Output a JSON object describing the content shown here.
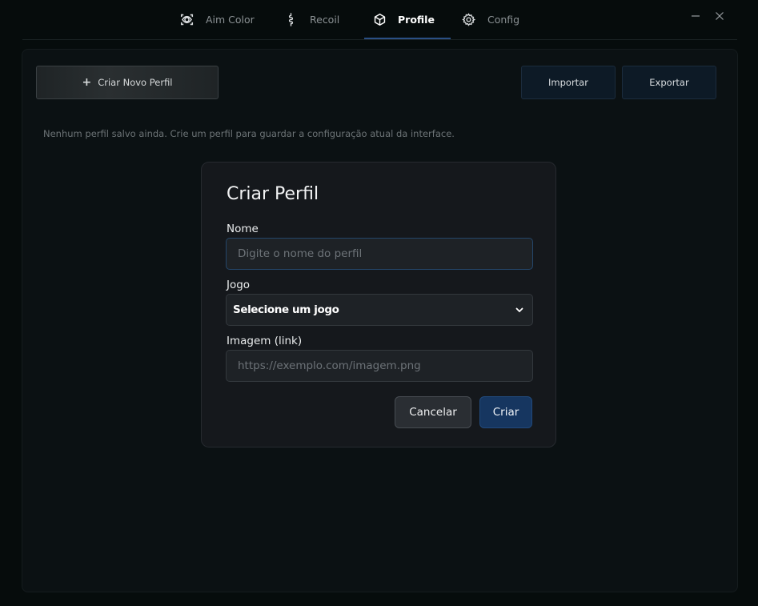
{
  "nav": {
    "tabs": [
      {
        "label": "Aim Color",
        "icon": "eye-target-icon"
      },
      {
        "label": "Recoil",
        "icon": "spiral-icon"
      },
      {
        "label": "Profile",
        "icon": "cube-icon"
      },
      {
        "label": "Config",
        "icon": "gear-icon"
      }
    ],
    "active_tab": "Profile"
  },
  "toolbar": {
    "new_profile_label": "Criar Novo Perfil",
    "import_label": "Importar",
    "export_label": "Exportar"
  },
  "empty_message": "Nenhum perfil salvo ainda. Crie um perfil para guardar a configuração atual da interface.",
  "modal": {
    "title": "Criar Perfil",
    "name_label": "Nome",
    "name_placeholder": "Digite o nome do perfil",
    "name_value": "",
    "game_label": "Jogo",
    "game_selected": "Selecione um jogo",
    "image_label": "Imagem (link)",
    "image_placeholder": "https://exemplo.com/imagem.png",
    "image_value": "",
    "cancel_label": "Cancelar",
    "create_label": "Criar"
  },
  "colors": {
    "background": "#060c0c",
    "panel": "#0b1113",
    "modal": "#15181c",
    "accent": "#163660",
    "tab_underline": "#2a4f84"
  }
}
